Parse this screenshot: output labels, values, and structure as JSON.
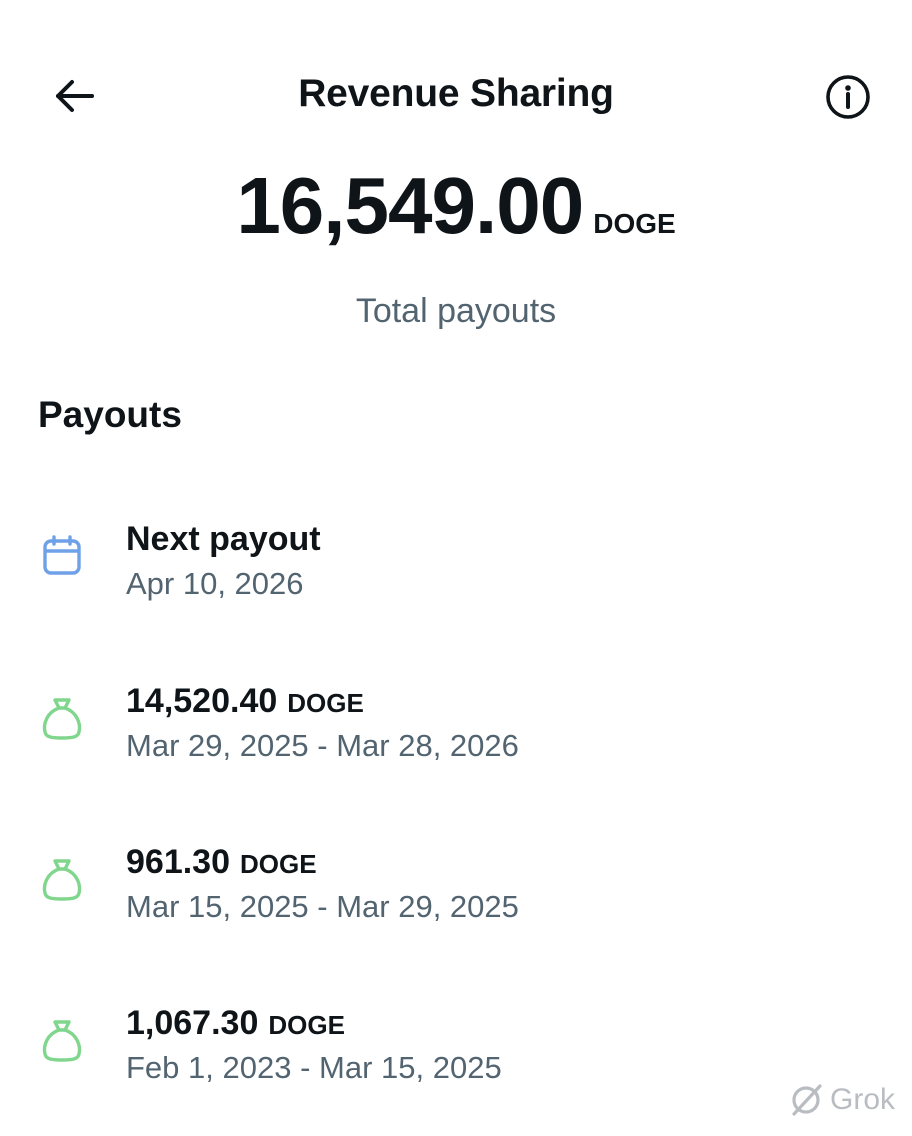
{
  "header": {
    "title": "Revenue Sharing",
    "back_icon": "arrow-left-icon",
    "info_icon": "info-circle-icon"
  },
  "total": {
    "amount": "16,549.00",
    "currency": "DOGE",
    "label": "Total payouts"
  },
  "payouts": {
    "section_title": "Payouts",
    "next_payout": {
      "icon": "calendar-icon",
      "title": "Next payout",
      "date": "Apr 10, 2026"
    },
    "items": [
      {
        "icon": "money-bag-icon",
        "amount": "14,520.40",
        "currency": "DOGE",
        "range": "Mar 29, 2025 - Mar 28, 2026"
      },
      {
        "icon": "money-bag-icon",
        "amount": "961.30",
        "currency": "DOGE",
        "range": "Mar 15, 2025 - Mar 29, 2025"
      },
      {
        "icon": "money-bag-icon",
        "amount": "1,067.30",
        "currency": "DOGE",
        "range": "Feb 1, 2023 - Mar 15, 2025"
      }
    ]
  },
  "watermark": {
    "text": "Grok"
  },
  "colors": {
    "text_primary": "#0f1419",
    "text_secondary": "#536471",
    "calendar_blue": "#6ea1e8",
    "bag_green": "#7fd68c",
    "watermark_gray": "#b9bdc2"
  }
}
